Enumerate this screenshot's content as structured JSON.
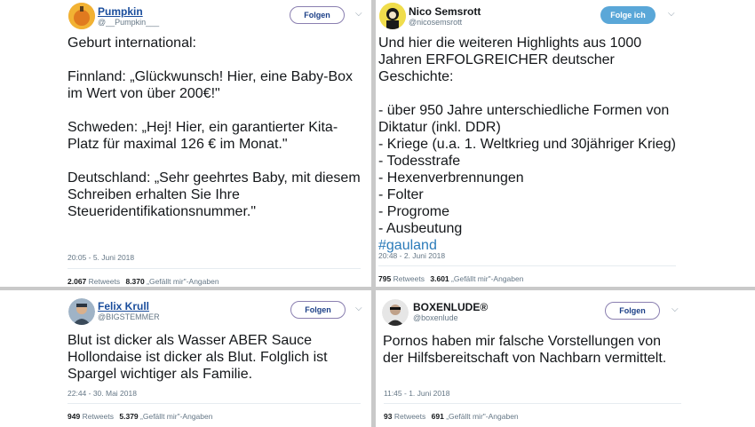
{
  "tweets": [
    {
      "name": "Pumpkin",
      "handle": "@__Pumpkin___",
      "follow_label": "Folgen",
      "text": "Geburt international:\n\nFinnland: „Glückwunsch! Hier, eine Baby-Box im Wert von über 200€!\"\n\nSchweden: „Hej! Hier, ein garantierter Kita-Platz für maximal 126 € im Monat.\"\n\nDeutschland: „Sehr geehrtes Baby, mit diesem Schreiben erhalten Sie Ihre Steueridentifikationsnummer.\"",
      "time": "20:05 - 5. Juni 2018",
      "retweets": "2.067",
      "retweets_label": "Retweets",
      "likes": "8.370",
      "likes_label": "„Gefällt mir\"-Angaben"
    },
    {
      "name": "Nico Semsrott",
      "handle": "@nicosemsrott",
      "follow_label": "Folge ich",
      "text": "Und hier die weiteren Highlights aus 1000 Jahren ERFOLGREICHER deutscher Geschichte:\n\n- über 950 Jahre unterschiedliche Formen von Diktatur (inkl. DDR)\n- Kriege (u.a. 1. Weltkrieg und 30jähriger Krieg)\n- Todesstrafe\n- Hexenverbrennungen\n- Folter\n- Progrome\n- Ausbeutung",
      "hashtag": "#gauland",
      "time": "20:48 - 2. Juni 2018",
      "retweets": "795",
      "retweets_label": "Retweets",
      "likes": "3.601",
      "likes_label": "„Gefällt mir\"-Angaben"
    },
    {
      "name": "Felix Krull",
      "handle": "@BIGSTEMMER",
      "follow_label": "Folgen",
      "text": "Blut ist dicker als Wasser ABER Sauce Hollondaise ist dicker als Blut. Folglich ist Spargel wichtiger als Familie.",
      "time": "22:44 - 30. Mai 2018",
      "retweets": "949",
      "retweets_label": "Retweets",
      "likes": "5.379",
      "likes_label": "„Gefällt mir\"-Angaben"
    },
    {
      "name": "BOXENLUDE®",
      "handle": "@boxenlude",
      "follow_label": "Folgen",
      "text": "Pornos haben mir falsche Vorstellungen von der Hilfsbereitschaft von Nachbarn vermittelt.",
      "time": "11:45 - 1. Juni 2018",
      "retweets": "93",
      "retweets_label": "Retweets",
      "likes": "691",
      "likes_label": "„Gefällt mir\"-Angaben"
    }
  ],
  "colors": {
    "link_blue": "#1a4d9c",
    "follow_solid": "#5aa7d8",
    "hashtag": "#2b7bb9",
    "divider": "#c9c9c9"
  },
  "icons": [
    "chevron-down-icon",
    "avatar"
  ]
}
